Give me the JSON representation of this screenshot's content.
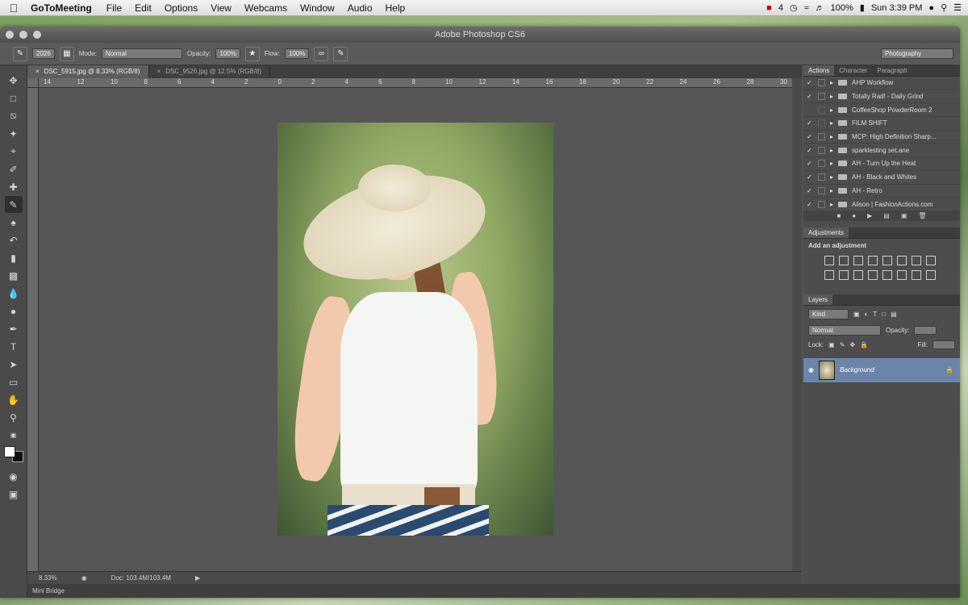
{
  "menubar": {
    "apple": "",
    "app_name": "GoToMeeting",
    "items": [
      "File",
      "Edit",
      "Options",
      "View",
      "Webcams",
      "Window",
      "Audio",
      "Help"
    ],
    "tray": {
      "adobe": "4",
      "battery": "100%",
      "clock": "Sun 3:39 PM"
    }
  },
  "window": {
    "title": "Adobe Photoshop CS6"
  },
  "options_bar": {
    "brush_size": "2026",
    "mode_label": "Mode:",
    "mode_value": "Normal",
    "opacity_label": "Opacity:",
    "opacity_value": "100%",
    "flow_label": "Flow:",
    "flow_value": "100%",
    "workspace": "Photography"
  },
  "tabs": [
    {
      "label": "DSC_5915.jpg @ 8.33% (RGB/8)"
    },
    {
      "label": "DSC_9526.jpg @ 12.5% (RGB/8)"
    }
  ],
  "ruler_labels": [
    "14",
    "12",
    "10",
    "8",
    "6",
    "4",
    "2",
    "0",
    "2",
    "4",
    "6",
    "8",
    "10",
    "12",
    "14",
    "16",
    "18",
    "20",
    "22",
    "24",
    "26",
    "28",
    "30"
  ],
  "status": {
    "zoom": "8.33%",
    "doc": "Doc: 103.4M/103.4M"
  },
  "mini_bridge": "Mini Bridge",
  "panels": {
    "actions_tabs": [
      "Actions",
      "Character",
      "Paragraph"
    ],
    "actions": [
      "AHP Workflow",
      "Totally Rad! - Daily Grind",
      "CoffeeShop PowderRoom 2",
      "FILM SHIFT",
      "MCP: High Definition Sharp...",
      "sparklesting set.ane",
      "AH - Turn Up the Heat",
      "AH - Black and Whites",
      "AH - Retro",
      "Alison | FashionActions.com"
    ],
    "adjustments_title": "Adjustments",
    "add_adjustment": "Add an adjustment",
    "layers_title": "Layers",
    "layers_kind": "Kind",
    "layers_blend": "Normal",
    "layers_opacity_label": "Opacity:",
    "layers_lock_label": "Lock:",
    "layers_fill_label": "Fill:",
    "layer_name": "Background"
  }
}
